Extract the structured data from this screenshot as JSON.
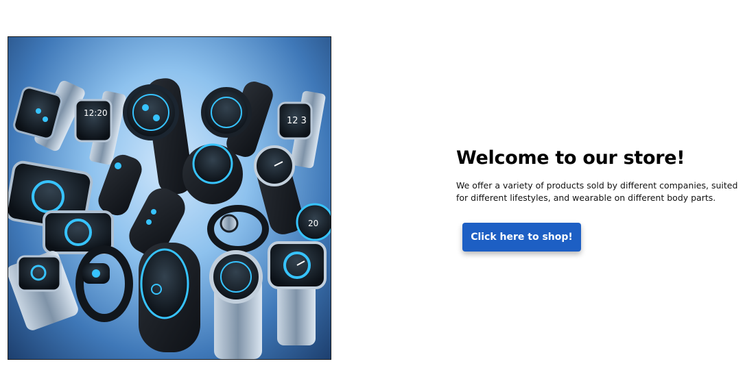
{
  "hero": {
    "image_alt": "Assortment of smartwatches, fitness bands and rings"
  },
  "welcome": {
    "title": "Welcome to our store!",
    "description": "We offer a variety of products sold by different companies, suited for different lifestyles, and wearable on different body parts.",
    "cta_label": "Click here to shop!"
  },
  "colors": {
    "button": "#1d5fc4",
    "accent_glow": "#37c3ff"
  },
  "icons": {
    "product_image": "smartwatch-collection-image"
  }
}
